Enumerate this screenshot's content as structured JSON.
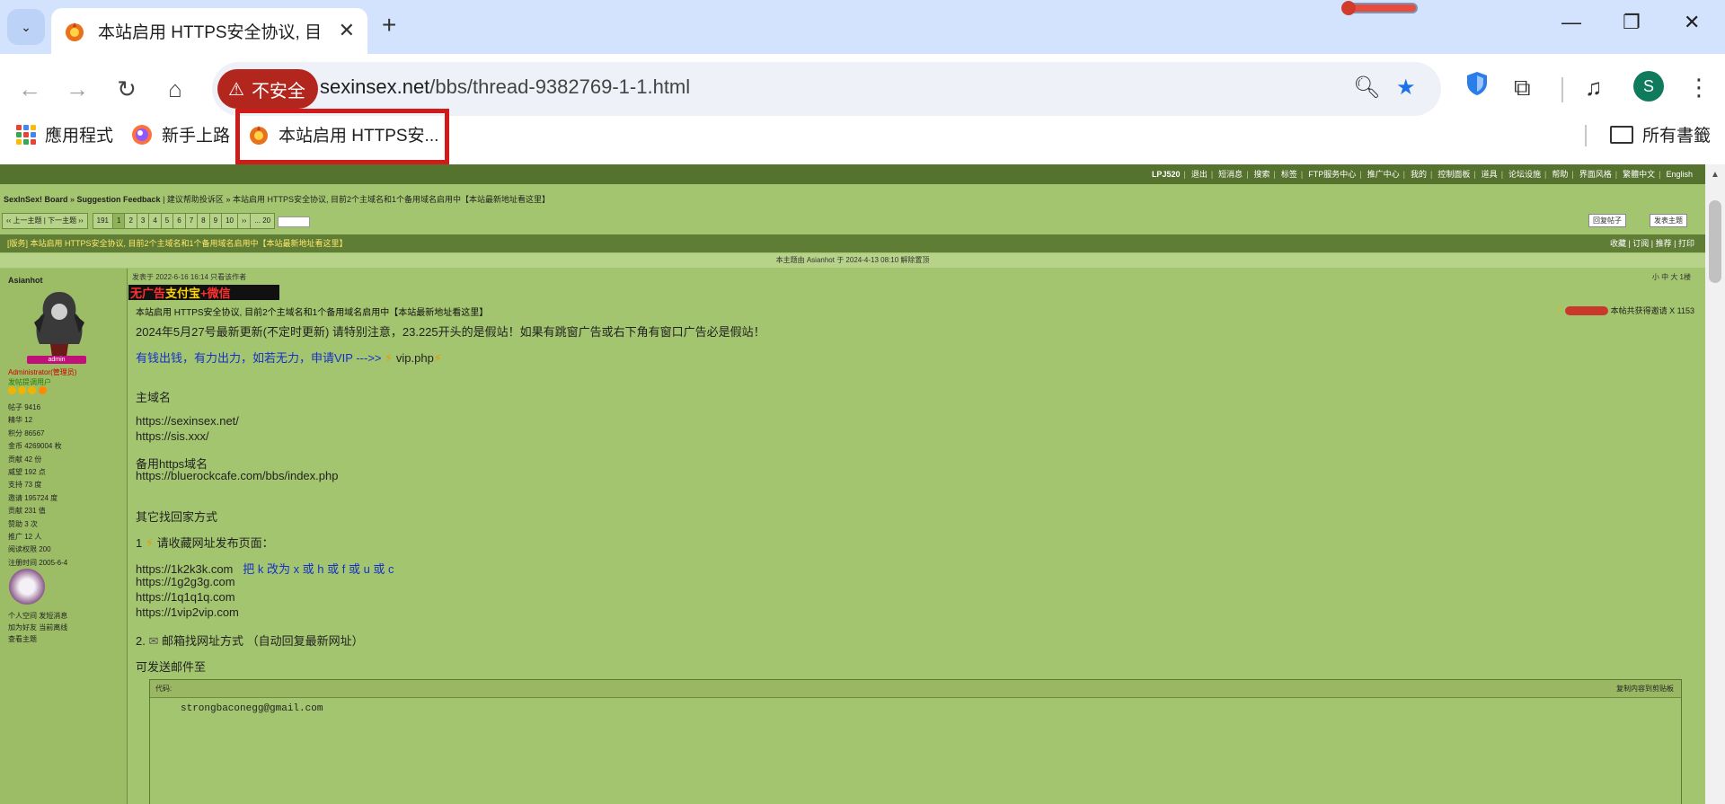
{
  "browser": {
    "tab_title": "本站启用 HTTPS安全协议, 目前",
    "insecure_label": "不安全",
    "url_host": "sexinsex.net",
    "url_path": "/bbs/thread-9382769-1-1.html",
    "profile_initial": "S",
    "bookmarks": [
      {
        "label": "應用程式",
        "icon": "apps-grid-icon"
      },
      {
        "label": "新手上路",
        "icon": "firefox-icon"
      },
      {
        "label": "本站启用 HTTPS安...",
        "icon": "site-favicon"
      }
    ],
    "all_bookmarks": "所有書籤",
    "accent_blue": "#1a73e8",
    "insecure_red": "#b3261e",
    "highlight_red": "#d01b1b"
  },
  "forum": {
    "user_menu": [
      "LPJ520",
      "退出",
      "短消息",
      "搜索",
      "标签",
      "FTP服务中心",
      "推广中心",
      "我的",
      "控制面板",
      "道具",
      "论坛设施",
      "帮助",
      "界面风格",
      "繁體中文",
      "English"
    ],
    "breadcrumb": {
      "board": "SexInSex! Board",
      "section": "Suggestion Feedback",
      "sub": "建议帮助投诉区",
      "thread": "本站启用 HTTPS安全协议, 目前2个主域名和1个备用域名启用中【本站最新地址看这里】"
    },
    "pager": {
      "prev_next": "‹‹ 上一主题 | 下一主题 ››",
      "total": "191",
      "pages": [
        "1",
        "2",
        "3",
        "4",
        "5",
        "6",
        "7",
        "8",
        "9",
        "10"
      ],
      "more": "››",
      "last": "... 20"
    },
    "buttons": {
      "reply": "回复帖子",
      "new_topic": "发表主题"
    },
    "thread_bar": {
      "title": "[版务] 本站启用 HTTPS安全协议, 目前2个主域名和1个备用域名启用中【本站最新地址看这里】",
      "actions": "收藏 | 订阅 | 推荐 | 打印"
    },
    "notice": "本主题由 Asianhot 于 2024-4-13 08:10 解除置顶",
    "author": {
      "name": "Asianhot",
      "badge": "admin",
      "role": "Administrator(管理员)",
      "group": "发帖提调用户",
      "stats": [
        "帖子 9416",
        "精华 12",
        "积分 86567",
        "金币 4269004 枚",
        "贡献 42 份",
        "威望 192 点",
        "支持 73 度",
        "邀请 195724 度",
        "贡献 231 值",
        "赞助 3 次",
        "推广 12 人",
        "阅读权限 200",
        "注册时间 2005-6-4"
      ],
      "actions": [
        "个人空间  发短消息",
        "加为好友  当前离线",
        "查看主题"
      ]
    },
    "post": {
      "meta": "发表于 2022-6-16 16:14  只看该作者",
      "meta_right": "小 中 大  1楼",
      "ad": [
        "无广告 ",
        "支付宝",
        "+微信"
      ],
      "title": "本站启用 HTTPS安全协议, 目前2个主域名和1个备用域名启用中【本站最新地址看这里】",
      "reward": "本帖共获得邀请 X 1153",
      "lines": [
        "2024年5月27号最新更新(不定时更新) 请特别注意，23.225开头的是假站！如果有跳窗广告或右下角有窗口广告必是假站！",
        "有钱出钱，有力出力，如若无力，申请VIP --->> ",
        "vip.php",
        "主域名",
        "https://sexinsex.net/",
        "https://sis.xxx/",
        "备用https域名",
        "https://bluerockcafe.com/bbs/index.php",
        "其它找回家方式",
        "1 ",
        "请收藏网址发布页面：",
        "https://1k2k3k.com",
        "把 k 改为 x 或 h 或 f 或 u 或 c",
        "https://1g2g3g.com",
        "https://1q1q1q.com",
        "https://1vip2vip.com",
        "2. ",
        "邮箱找网址方式 （自动回复最新网址）",
        "可发送邮件至"
      ],
      "code_label": "代码:",
      "code_copy": "复制内容到剪贴板",
      "code": "strongbaconegg@gmail.com"
    }
  }
}
